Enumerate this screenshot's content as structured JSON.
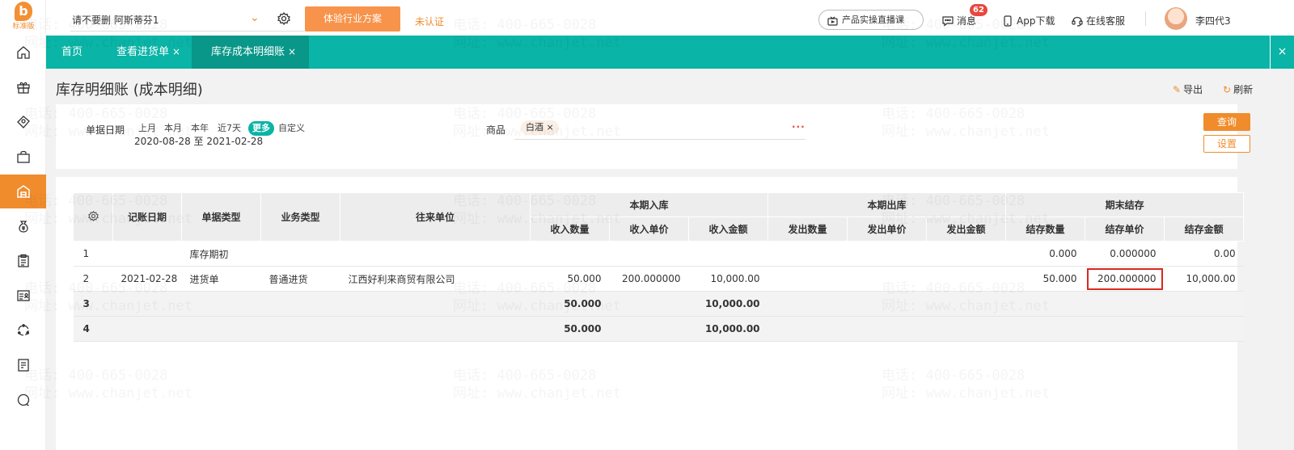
{
  "logo": {
    "mark": "b",
    "text": "标准版"
  },
  "sidebar": {
    "items": [
      {
        "name": "home-icon"
      },
      {
        "name": "gift-icon"
      },
      {
        "name": "tag-icon"
      },
      {
        "name": "bag-icon"
      },
      {
        "name": "warehouse-icon",
        "active": true
      },
      {
        "name": "money-bag-icon"
      },
      {
        "name": "clipboard-icon"
      },
      {
        "name": "card-icon"
      },
      {
        "name": "cycle-icon"
      },
      {
        "name": "report-icon"
      },
      {
        "name": "chat-icon"
      }
    ]
  },
  "header": {
    "account": "请不要删 阿斯蒂芬1",
    "plan_button": "体验行业方案",
    "unverified": "未认证",
    "live_course": "产品实操直播课",
    "messages": "消息",
    "message_count": "62",
    "app_download": "App下载",
    "online_service": "在线客服",
    "username": "李四代3"
  },
  "tabs": [
    {
      "label": "首页",
      "closable": false
    },
    {
      "label": "查看进货单",
      "closable": true
    },
    {
      "label": "库存成本明细账",
      "closable": true,
      "active": true
    }
  ],
  "tab_close_icon": "×",
  "page": {
    "title": "库存明细账 (成本明细)",
    "export": "导出",
    "refresh": "刷新"
  },
  "filters": {
    "date_label": "单据日期",
    "quick_dates": [
      "上月",
      "本月",
      "本年",
      "近7天",
      "更多",
      "自定义"
    ],
    "active_quick": "更多",
    "date_range": "2020-08-28 至 2021-02-28",
    "product_label": "商品",
    "product_value": "白酒",
    "product_remove": "×",
    "more_dots": "...",
    "query": "查询",
    "settings": "设置"
  },
  "table": {
    "headers": {
      "date": "记账日期",
      "doc_type": "单据类型",
      "biz_type": "业务类型",
      "partner": "往来单位",
      "in_group": "本期入库",
      "out_group": "本期出库",
      "end_group": "期末结存",
      "in_qty": "收入数量",
      "in_price": "收入单价",
      "in_amount": "收入金额",
      "out_qty": "发出数量",
      "out_price": "发出单价",
      "out_amount": "发出金额",
      "end_qty": "结存数量",
      "end_price": "结存单价",
      "end_amount": "结存金额"
    },
    "rows": [
      {
        "idx": "1",
        "date": "",
        "doc_type": "库存期初",
        "biz_type": "",
        "partner": "",
        "in_qty": "",
        "in_price": "",
        "in_amount": "",
        "out_qty": "",
        "out_price": "",
        "out_amount": "",
        "end_qty": "0.000",
        "end_price": "0.000000",
        "end_amount": "0.00"
      },
      {
        "idx": "2",
        "date": "2021-02-28",
        "doc_type": "进货单",
        "biz_type": "普通进货",
        "partner": "江西好利来商贸有限公司",
        "in_qty": "50.000",
        "in_price": "200.000000",
        "in_amount": "10,000.00",
        "out_qty": "",
        "out_price": "",
        "out_amount": "",
        "end_qty": "50.000",
        "end_price": "200.000000",
        "end_amount": "10,000.00"
      },
      {
        "idx": "3",
        "date": "",
        "doc_type": "",
        "biz_type": "",
        "partner": "",
        "in_qty": "50.000",
        "in_price": "",
        "in_amount": "10,000.00",
        "out_qty": "",
        "out_price": "",
        "out_amount": "",
        "end_qty": "",
        "end_price": "",
        "end_amount": ""
      },
      {
        "idx": "4",
        "date": "",
        "doc_type": "",
        "biz_type": "",
        "partner": "",
        "in_qty": "50.000",
        "in_price": "",
        "in_amount": "10,000.00",
        "out_qty": "",
        "out_price": "",
        "out_amount": "",
        "end_qty": "",
        "end_price": "",
        "end_amount": ""
      }
    ]
  },
  "watermark": {
    "phone": "电话: 400-665-0028",
    "site": "网址: www.chanjet.net"
  },
  "colors": {
    "accent": "#f08c2b",
    "teal": "#0ab4a6",
    "teal_dark": "#089788",
    "highlight": "#d9281f"
  }
}
